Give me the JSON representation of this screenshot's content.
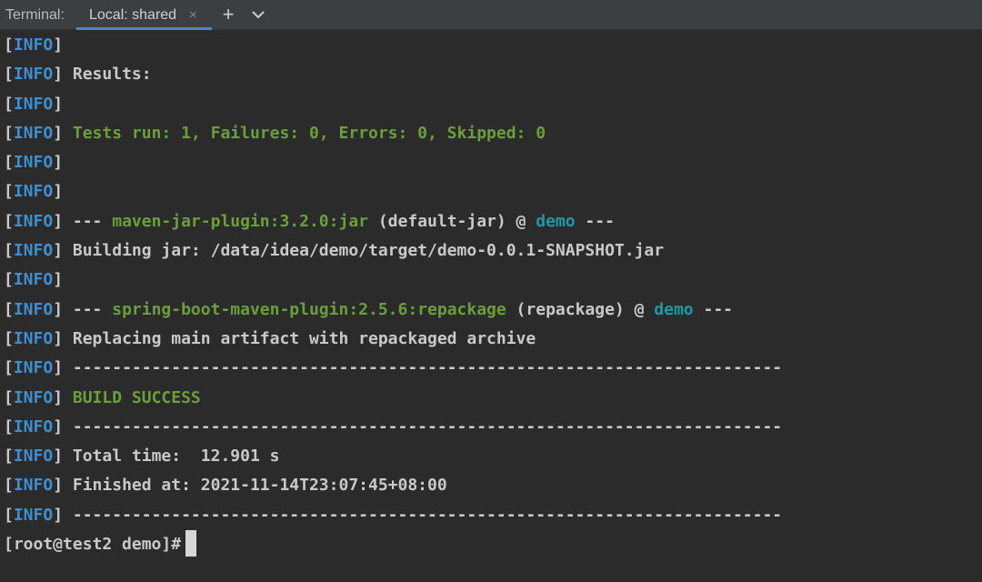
{
  "tabbar": {
    "title": "Terminal:",
    "active_tab": "Local: shared",
    "close_glyph": "×",
    "add_glyph": "+",
    "icons": [
      "close-icon",
      "plus-icon",
      "chevron-down-icon"
    ]
  },
  "colors": {
    "info": "#3d8fd1",
    "success": "#6a9f3a",
    "project": "#1c9aa8",
    "tab_underline": "#4a88c7"
  },
  "log": {
    "open": "[",
    "tag": "INFO",
    "close": "]",
    "lines": {
      "l1": "",
      "l2": " Results:",
      "l3": "",
      "l4": " Tests run: 1, Failures: 0, Errors: 0, Skipped: 0",
      "l5": "",
      "l6": "",
      "l7": {
        "pre": " --- ",
        "plugin": "maven-jar-plugin:3.2.0:jar",
        "goal": " (default-jar) @ ",
        "project": "demo",
        "post": " ---"
      },
      "l8": " Building jar: /data/idea/demo/target/demo-0.0.1-SNAPSHOT.jar",
      "l9": "",
      "l10": {
        "pre": " --- ",
        "plugin": "spring-boot-maven-plugin:2.5.6:repackage",
        "goal": " (repackage) @ ",
        "project": "demo",
        "post": " ---"
      },
      "l11": " Replacing main artifact with repackaged archive",
      "l12": " ------------------------------------------------------------------------",
      "l13": " BUILD SUCCESS",
      "l14": " ------------------------------------------------------------------------",
      "l15": " Total time:  12.901 s",
      "l16": " Finished at: 2021-11-14T23:07:45+08:00",
      "l17": " ------------------------------------------------------------------------"
    },
    "prompt": "[root@test2 demo]#"
  }
}
